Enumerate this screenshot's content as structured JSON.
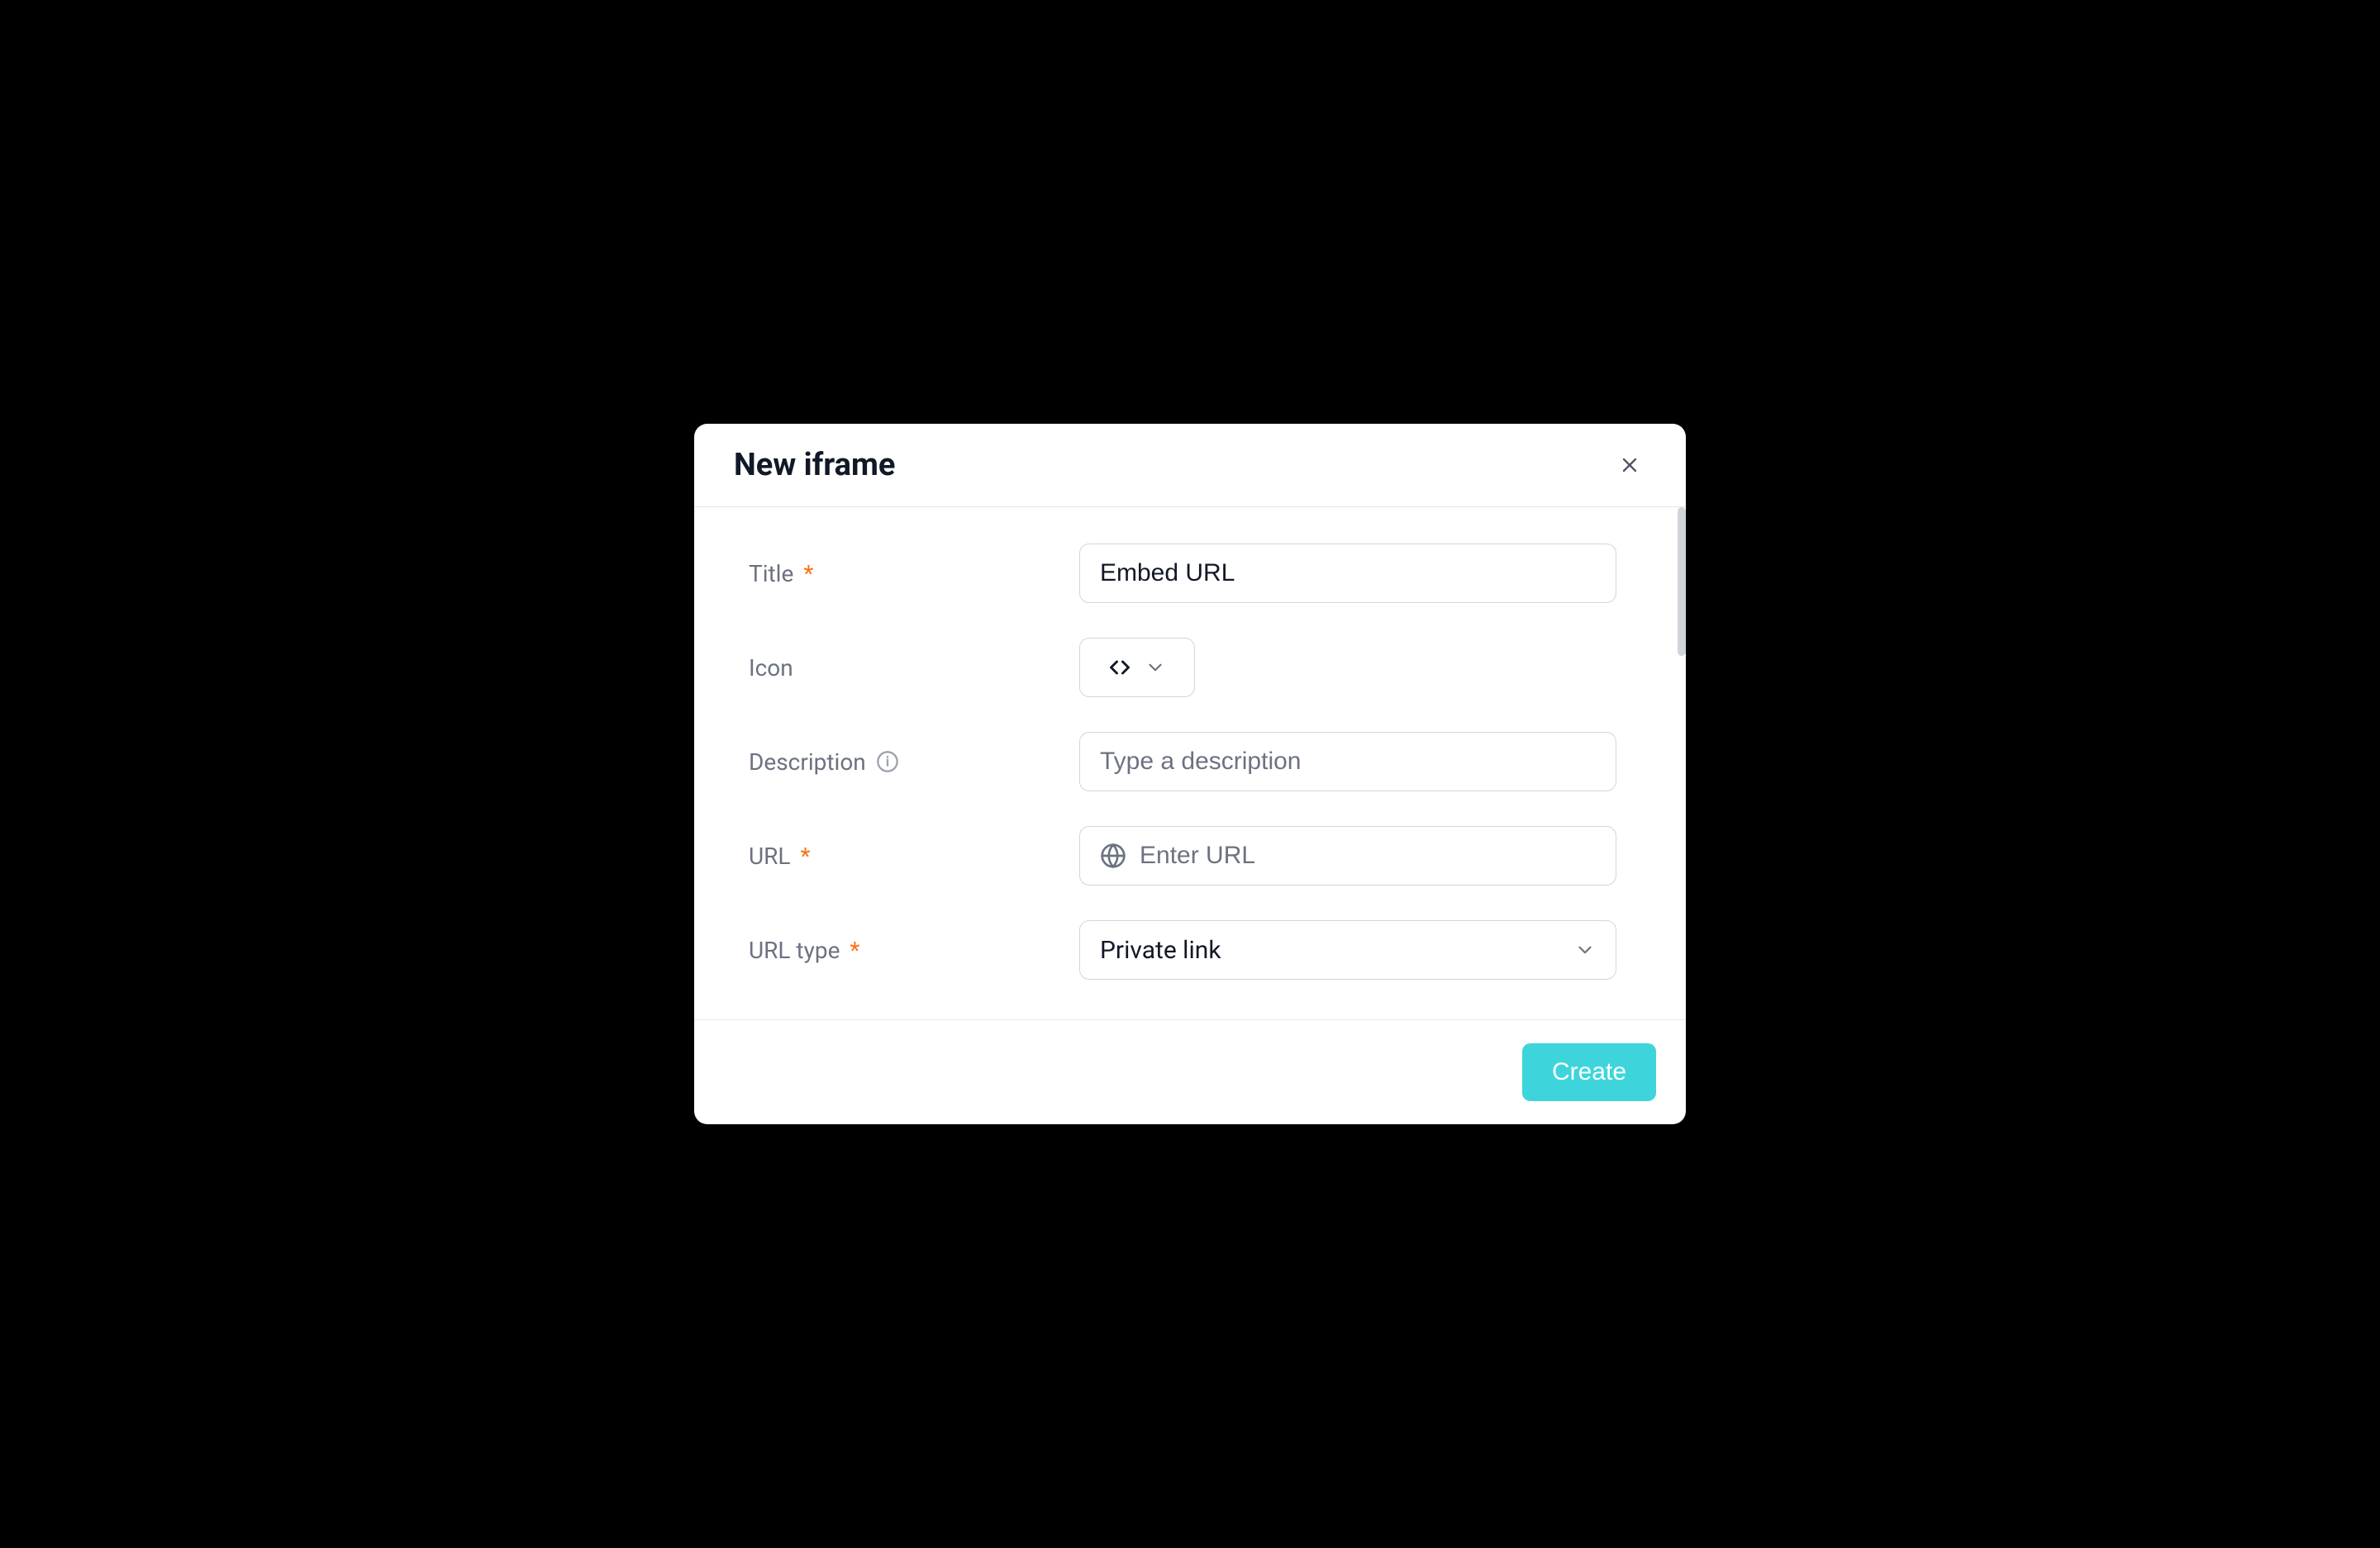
{
  "modal": {
    "title": "New iframe",
    "fields": {
      "title": {
        "label": "Title",
        "value": "Embed URL",
        "required": true
      },
      "icon": {
        "label": "Icon"
      },
      "description": {
        "label": "Description",
        "placeholder": "Type a description"
      },
      "url": {
        "label": "URL",
        "placeholder": "Enter URL",
        "required": true
      },
      "urlType": {
        "label": "URL type",
        "value": "Private link",
        "required": true
      }
    },
    "footer": {
      "createLabel": "Create"
    }
  }
}
